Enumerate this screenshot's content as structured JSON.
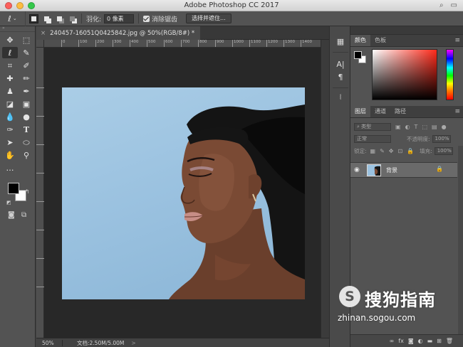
{
  "window": {
    "title": "Adobe Photoshop CC 2017"
  },
  "options_bar": {
    "feather_label": "羽化:",
    "feather_value": "0 像素",
    "antialias_label": "消除锯齿",
    "select_mask_button": "选择并遮住..."
  },
  "document": {
    "tab_title": "240457-16051Q0425842.jpg @ 50%(RGB/8#) *",
    "close_glyph": "×"
  },
  "ruler": {
    "top_ticks": [
      "0",
      "100",
      "200",
      "300",
      "400",
      "500",
      "600",
      "700",
      "800",
      "900",
      "1000",
      "1100",
      "1200",
      "1300",
      "1400",
      "1500"
    ]
  },
  "status": {
    "zoom": "50%",
    "doc_info": "文档:2.50M/5.00M",
    "arrow": ">"
  },
  "color_panel": {
    "tabs": [
      "颜色",
      "色板"
    ],
    "active_tab": "颜色",
    "foreground": "#000000",
    "background": "#ffffff",
    "picker_hue": "#ff2a1a"
  },
  "layers_panel": {
    "tabs": [
      "图层",
      "通道",
      "路径"
    ],
    "active_tab": "图层",
    "filter_label": "类型",
    "blend_mode": "正常",
    "opacity_label": "不透明度:",
    "opacity_value": "100%",
    "lock_label": "锁定:",
    "fill_label": "填充:",
    "fill_value": "100%",
    "layers": [
      {
        "name": "背景",
        "visible": true,
        "locked": true
      }
    ],
    "bottom_icons": [
      "link-icon",
      "fx-icon",
      "mask-icon",
      "adjustment-icon",
      "group-icon",
      "new-layer-icon",
      "delete-icon"
    ],
    "bottom_labels": [
      "∞",
      "fx"
    ]
  },
  "watermark": {
    "logo_letter": "S",
    "brand": "搜狗指南",
    "url": "zhinan.sogou.com"
  }
}
